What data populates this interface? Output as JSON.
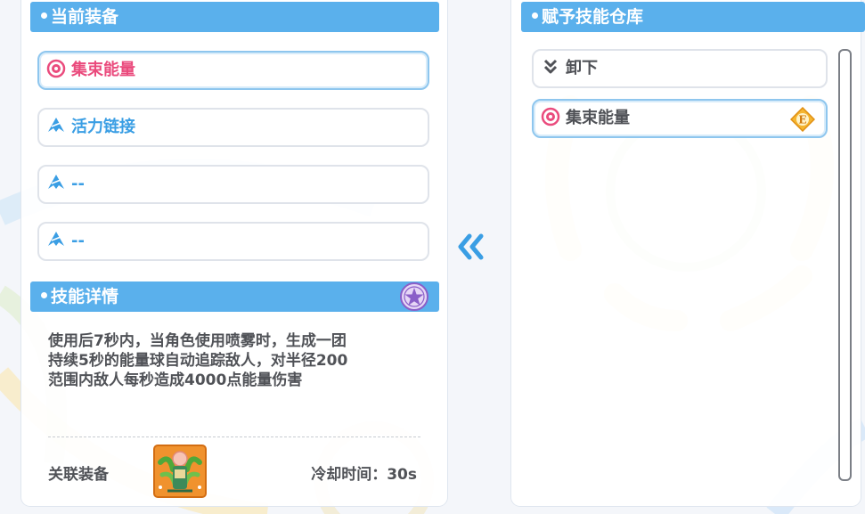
{
  "left": {
    "current_equipment_title": "当前装备",
    "slots": [
      {
        "label": "集束能量",
        "icon": "energy-burst-icon",
        "state": "selected"
      },
      {
        "label": "活力链接",
        "icon": "vitality-link-icon"
      },
      {
        "label": "--",
        "icon": "empty-skill-icon"
      },
      {
        "label": "--",
        "icon": "empty-skill-icon"
      }
    ],
    "skill_detail_title": "技能详情",
    "skill_detail_badge_icon": "star-emblem-icon",
    "description_lines": [
      "使用后7秒内，当角色使用喷雾时，生成一团",
      "持续5秒的能量球自动追踪敌人，对半径200",
      "范围内敌人每秒造成4000点能量伤害"
    ],
    "linked_equipment_label": "关联装备",
    "linked_equipment_icon": "gear-card-icon",
    "cooldown_label": "冷却时间：",
    "cooldown_value": "30s"
  },
  "middle": {
    "transfer_icon": "double-chevron-left-icon"
  },
  "right": {
    "title": "赋予技能仓库",
    "items": [
      {
        "label": "卸下",
        "icon": "unequip-chevron-icon"
      },
      {
        "label": "集束能量",
        "icon": "energy-burst-icon",
        "badge": "E",
        "state": "selected"
      }
    ]
  },
  "colors": {
    "header": "#5ab0ec",
    "pink_text": "#ea4b7d",
    "blue_text": "#3a9ee4",
    "body_text": "#505257"
  }
}
